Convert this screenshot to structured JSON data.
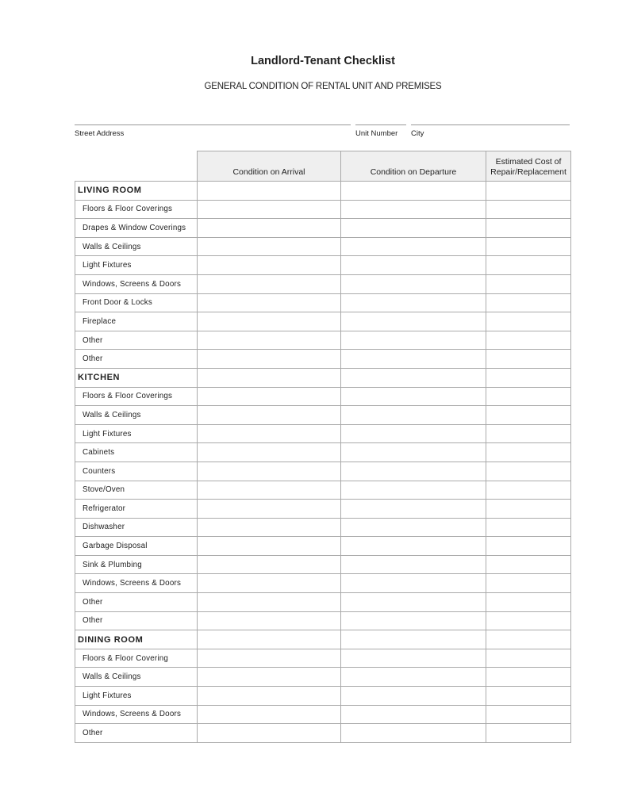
{
  "title": "Landlord-Tenant Checklist",
  "subtitle": "GENERAL CONDITION OF RENTAL UNIT AND PREMISES",
  "fields": {
    "street_address": {
      "label": "Street Address",
      "value": ""
    },
    "unit_number": {
      "label": "Unit Number",
      "value": ""
    },
    "city": {
      "label": "City",
      "value": ""
    }
  },
  "table": {
    "headers": [
      "",
      "Condition on Arrival",
      "Condition on Departure",
      "Estimated Cost of Repair/Replacement"
    ],
    "sections": [
      {
        "name": "LIVING ROOM",
        "items": [
          "Floors & Floor Coverings",
          "Drapes & Window Coverings",
          "Walls & Ceilings",
          "Light Fixtures",
          "Windows, Screens & Doors",
          "Front Door & Locks",
          "Fireplace",
          "Other",
          "Other"
        ]
      },
      {
        "name": "KITCHEN",
        "items": [
          "Floors & Floor Coverings",
          "Walls & Ceilings",
          "Light Fixtures",
          "Cabinets",
          "Counters",
          "Stove/Oven",
          "Refrigerator",
          "Dishwasher",
          "Garbage Disposal",
          "Sink & Plumbing",
          "Windows, Screens & Doors",
          "Other",
          "Other"
        ]
      },
      {
        "name": "DINING ROOM",
        "items": [
          "Floors & Floor Covering",
          "Walls & Ceilings",
          "Light Fixtures",
          "Windows, Screens & Doors",
          "Other"
        ]
      }
    ]
  }
}
